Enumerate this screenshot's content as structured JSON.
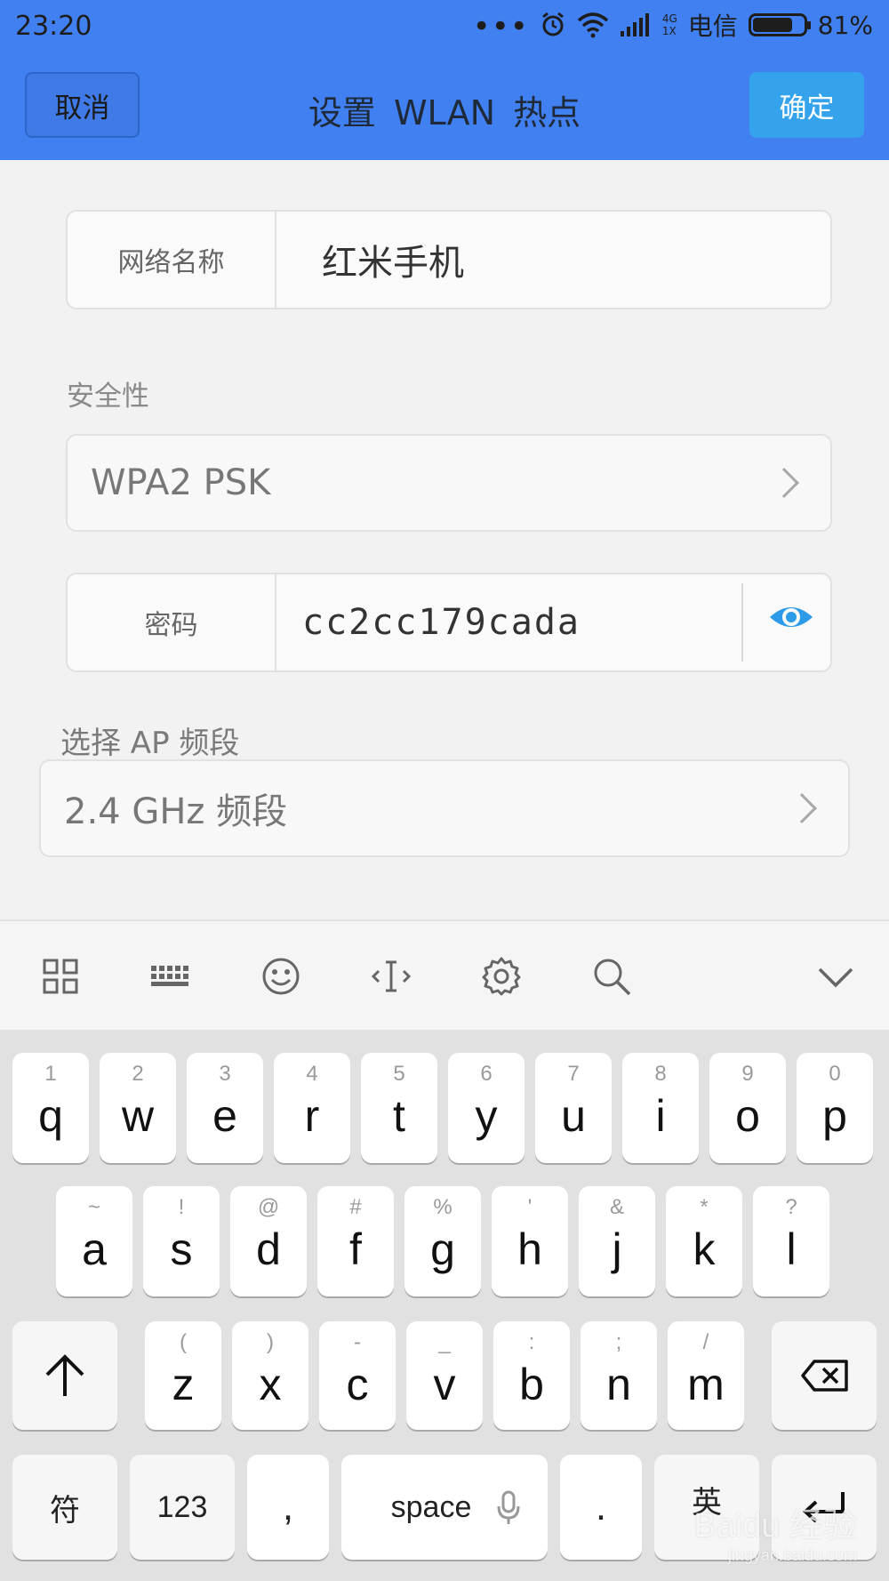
{
  "status_bar": {
    "time": "23:20",
    "dots": "•••",
    "net_top": "4G",
    "net_bottom": "1X",
    "carrier": "电信",
    "battery_level": 0.81,
    "battery_text": "81%"
  },
  "header": {
    "cancel_label": "取消",
    "title": "设置 WLAN 热点",
    "confirm_label": "确定",
    "bg_color": "#4180f1",
    "confirm_color": "#35a3ec"
  },
  "form": {
    "network_name_label": "网络名称",
    "network_name_value": "红米手机",
    "security_label": "安全性",
    "security_value": "WPA2 PSK",
    "password_label": "密码",
    "password_value": "cc2cc179cada",
    "ap_band_label": "选择 AP 频段",
    "ap_band_value": "2.4 GHz 频段",
    "eye_color": "#2d9be8"
  },
  "keyboard": {
    "toolbar_icons": [
      "grid-icon",
      "keyboard-icon",
      "emoji-icon",
      "cursor-icon",
      "gear-icon",
      "search-icon",
      "chevron-down-icon"
    ],
    "row1": [
      {
        "hint": "1",
        "key": "q"
      },
      {
        "hint": "2",
        "key": "w"
      },
      {
        "hint": "3",
        "key": "e"
      },
      {
        "hint": "4",
        "key": "r"
      },
      {
        "hint": "5",
        "key": "t"
      },
      {
        "hint": "6",
        "key": "y"
      },
      {
        "hint": "7",
        "key": "u"
      },
      {
        "hint": "8",
        "key": "i"
      },
      {
        "hint": "9",
        "key": "o"
      },
      {
        "hint": "0",
        "key": "p"
      }
    ],
    "row2": [
      {
        "hint": "~",
        "key": "a"
      },
      {
        "hint": "!",
        "key": "s"
      },
      {
        "hint": "@",
        "key": "d"
      },
      {
        "hint": "#",
        "key": "f"
      },
      {
        "hint": "%",
        "key": "g"
      },
      {
        "hint": "'",
        "key": "h"
      },
      {
        "hint": "&",
        "key": "j"
      },
      {
        "hint": "*",
        "key": "k"
      },
      {
        "hint": "?",
        "key": "l"
      }
    ],
    "row3": [
      {
        "hint": "(",
        "key": "z"
      },
      {
        "hint": ")",
        "key": "x"
      },
      {
        "hint": "-",
        "key": "c"
      },
      {
        "hint": "_",
        "key": "v"
      },
      {
        "hint": ":",
        "key": "b"
      },
      {
        "hint": ";",
        "key": "n"
      },
      {
        "hint": "/",
        "key": "m"
      }
    ],
    "symbol_label": "符",
    "numbers_label": "123",
    "comma_label": ",",
    "space_label": "space",
    "period_label": ".",
    "lang_label": "英",
    "watermark": "Baidu 经验",
    "watermark_sub": "jingyan.baidu.com"
  }
}
